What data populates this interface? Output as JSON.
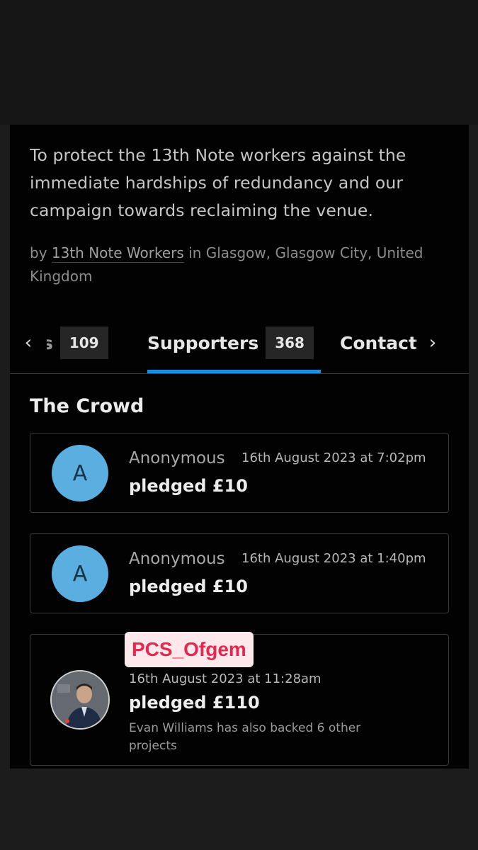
{
  "project": {
    "description": "To protect the 13th Note workers against the immediate hardships of redundancy and our campaign towards reclaiming the venue.",
    "by_prefix": "by",
    "owner": "13th Note Workers",
    "location": "in Glasgow, Glasgow City, United Kingdom"
  },
  "tabs": {
    "left_arrow": "‹",
    "right_arrow": "›",
    "items": [
      {
        "label": "ts",
        "count": "109"
      },
      {
        "label": "Supporters",
        "count": "368"
      },
      {
        "label": "Contact",
        "count": ""
      }
    ],
    "active_index": 1
  },
  "crowd": {
    "title": "The Crowd",
    "pledges": [
      {
        "initial": "A",
        "name": "Anonymous",
        "date": "16th August 2023 at 7:02pm",
        "pledge": "pledged £10",
        "note": ""
      },
      {
        "initial": "A",
        "name": "Anonymous",
        "date": "16th August 2023 at 1:40pm",
        "pledge": "pledged £10",
        "note": ""
      },
      {
        "initial": "",
        "name": "",
        "date": "16th August 2023 at 11:28am",
        "pledge": "pledged £110",
        "note": "Evan Williams has also backed 6 other projects"
      }
    ]
  },
  "overlay": {
    "sticker": "PCS_Ofgem"
  },
  "colors": {
    "accent": "#1d8fe0",
    "avatar": "#5aaee0",
    "sticker_text": "#e5284f",
    "sticker_bg": "#fde8ec"
  }
}
